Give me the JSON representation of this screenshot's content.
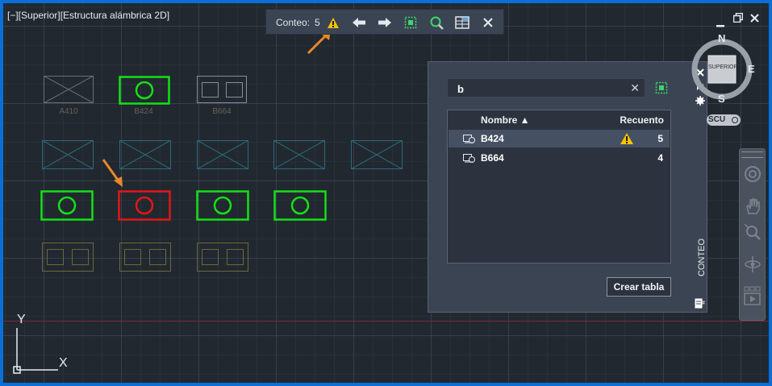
{
  "viewport": {
    "label": "[−][Superior][Estructura alámbrica 2D]"
  },
  "toolbar": {
    "label": "Conteo:",
    "count": "5",
    "icons": [
      "warning-icon",
      "arrow-left-icon",
      "arrow-right-icon",
      "select-region-icon",
      "zoom-objects-icon",
      "table-icon",
      "close-icon"
    ]
  },
  "blocks": [
    {
      "label": "A410"
    },
    {
      "label": "B424"
    },
    {
      "label": "B664"
    }
  ],
  "palette": {
    "search_value": "b",
    "columns": {
      "name": "Nombre ▲",
      "count": "Recuento"
    },
    "rows": [
      {
        "name": "B424",
        "count": "5",
        "warning": true
      },
      {
        "name": "B664",
        "count": "4",
        "warning": false
      }
    ],
    "create_table": "Crear tabla",
    "tab_title": "CONTEO"
  },
  "viewcube": {
    "n": "N",
    "e": "E",
    "s": "S",
    "face": "SUPERIOR",
    "ucs": "SCU"
  },
  "ucs_axes": {
    "y": "Y",
    "x": "X"
  },
  "colors": {
    "selected_green": "#16e016",
    "error_red": "#e41616",
    "warning_yellow": "#f5c400",
    "arrow_orange": "#e8892a"
  }
}
